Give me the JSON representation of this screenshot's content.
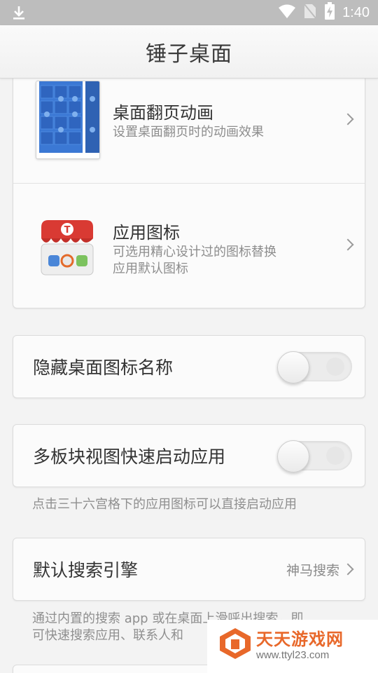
{
  "status_bar": {
    "time": "1:40",
    "icons": [
      "download-icon",
      "wifi-icon",
      "no-sim-icon",
      "battery-charging-icon"
    ]
  },
  "header": {
    "title": "锤子桌面"
  },
  "page_turn": {
    "title": "桌面翻页动画",
    "subtitle": "设置桌面翻页时的动画效果"
  },
  "app_icons": {
    "title": "应用图标",
    "subtitle_line1": "可选用精心设计过的图标替换",
    "subtitle_line2": "应用默认图标",
    "store_letter": "T"
  },
  "hide_names": {
    "label": "隐藏桌面图标名称",
    "on": false
  },
  "multi_block": {
    "label": "多板块视图快速启动应用",
    "on": false,
    "hint": "点击三十六宫格下的应用图标可以直接启动应用"
  },
  "search_engine": {
    "label": "默认搜索引擎",
    "value": "神马搜索",
    "hint_line1": "通过内置的搜索 app 或在桌面上滑呼出搜索，即",
    "hint_line2": "可快速搜索应用、联系人和"
  },
  "watermark": {
    "title": "天天游戏网",
    "url": "www.ttyl23.com"
  },
  "colors": {
    "status_bar": "#bdbdbd",
    "accent_blue": "#3b78d4",
    "store_red": "#d93a33",
    "watermark_orange": "#e8682a"
  }
}
